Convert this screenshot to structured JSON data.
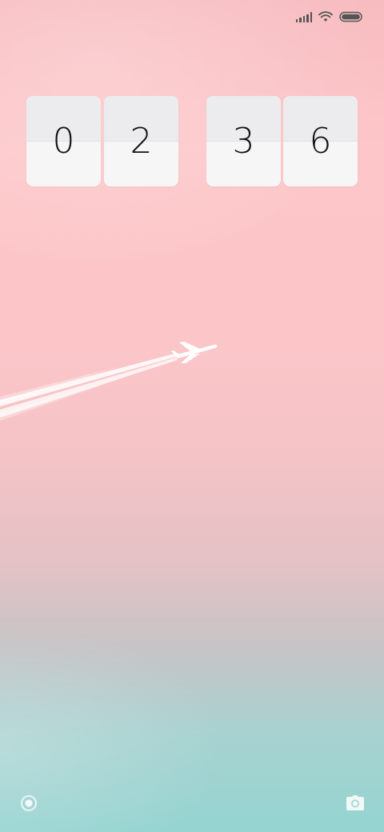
{
  "status_bar": {
    "signal_icon": "cellular-signal-icon",
    "wifi_icon": "wifi-icon",
    "battery_icon": "battery-icon",
    "icon_color": "#555555"
  },
  "clock": {
    "hour_tens": "0",
    "hour_ones": "2",
    "minute_tens": "3",
    "minute_ones": "6"
  },
  "wallpaper": {
    "top_color": "#f7bcc0",
    "bottom_color": "#94d4d1",
    "subject_icon": "airplane-icon"
  },
  "shortcuts": {
    "left_icon": "control-center-icon",
    "right_icon": "camera-icon"
  }
}
